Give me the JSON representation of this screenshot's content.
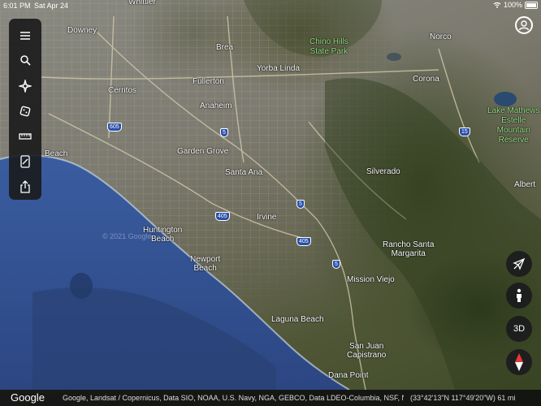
{
  "status_bar": {
    "time": "6:01 PM",
    "date": "Sat Apr 24",
    "battery": "100%"
  },
  "toolbar": {
    "items": [
      {
        "name": "menu-icon"
      },
      {
        "name": "search-icon"
      },
      {
        "name": "voyager-icon"
      },
      {
        "name": "feeling-lucky-icon"
      },
      {
        "name": "measure-icon"
      },
      {
        "name": "projects-icon"
      },
      {
        "name": "share-icon"
      }
    ]
  },
  "map": {
    "places": [
      {
        "key": "whittier",
        "name": "Whittier"
      },
      {
        "key": "downey",
        "name": "Downey"
      },
      {
        "key": "brea",
        "name": "Brea"
      },
      {
        "key": "yorba_linda",
        "name": "Yorba Linda"
      },
      {
        "key": "fullerton",
        "name": "Fullerton"
      },
      {
        "key": "cerritos",
        "name": "Cerritos"
      },
      {
        "key": "anaheim",
        "name": "Anaheim"
      },
      {
        "key": "garden_grove",
        "name": "Garden Grove"
      },
      {
        "key": "beach",
        "name": "Beach"
      },
      {
        "key": "santa_ana",
        "name": "Santa Ana"
      },
      {
        "key": "norco",
        "name": "Norco"
      },
      {
        "key": "corona",
        "name": "Corona"
      },
      {
        "key": "silverado",
        "name": "Silverado"
      },
      {
        "key": "irvine",
        "name": "Irvine"
      },
      {
        "key": "huntington_beach",
        "name": "Huntington\nBeach"
      },
      {
        "key": "newport_beach",
        "name": "Newport\nBeach"
      },
      {
        "key": "rancho_santa_margarita",
        "name": "Rancho Santa\nMargarita"
      },
      {
        "key": "mission_viejo",
        "name": "Mission Viejo"
      },
      {
        "key": "laguna_beach",
        "name": "Laguna Beach"
      },
      {
        "key": "san_juan_capistrano",
        "name": "San Juan\nCapistrano"
      },
      {
        "key": "dana_point",
        "name": "Dana Point"
      },
      {
        "key": "albert",
        "name": "Albert"
      }
    ],
    "parks": [
      {
        "key": "chino_hills",
        "name": "Chino Hills\nState Park"
      },
      {
        "key": "lake_mathews",
        "name": "Lake Mathews\nEstelle\nMountain\nReserve"
      }
    ],
    "highways": [
      {
        "key": "h605",
        "number": "605"
      },
      {
        "key": "h5a",
        "number": "5"
      },
      {
        "key": "h15",
        "number": "15"
      },
      {
        "key": "h405a",
        "number": "405"
      },
      {
        "key": "h5b",
        "number": "5"
      },
      {
        "key": "h405b",
        "number": "405"
      },
      {
        "key": "h5c",
        "number": "5"
      }
    ],
    "sea_watermark": "© 2021 Google"
  },
  "controls": {
    "toggle_3d": "3D",
    "compass_icon": "compass-icon",
    "pegman_icon": "pegman-icon",
    "location_icon": "location-off-icon"
  },
  "bottom_bar": {
    "logo": "Google",
    "attribution": "Google, Landsat / Copernicus, Data SIO, NOAA, U.S. Navy, NGA, GEBCO, Data LDEO-Columbia, NSF, NOAA, Data...",
    "coordinates": "(33°42'13\"N 117°49'20\"W) 61 mi"
  }
}
